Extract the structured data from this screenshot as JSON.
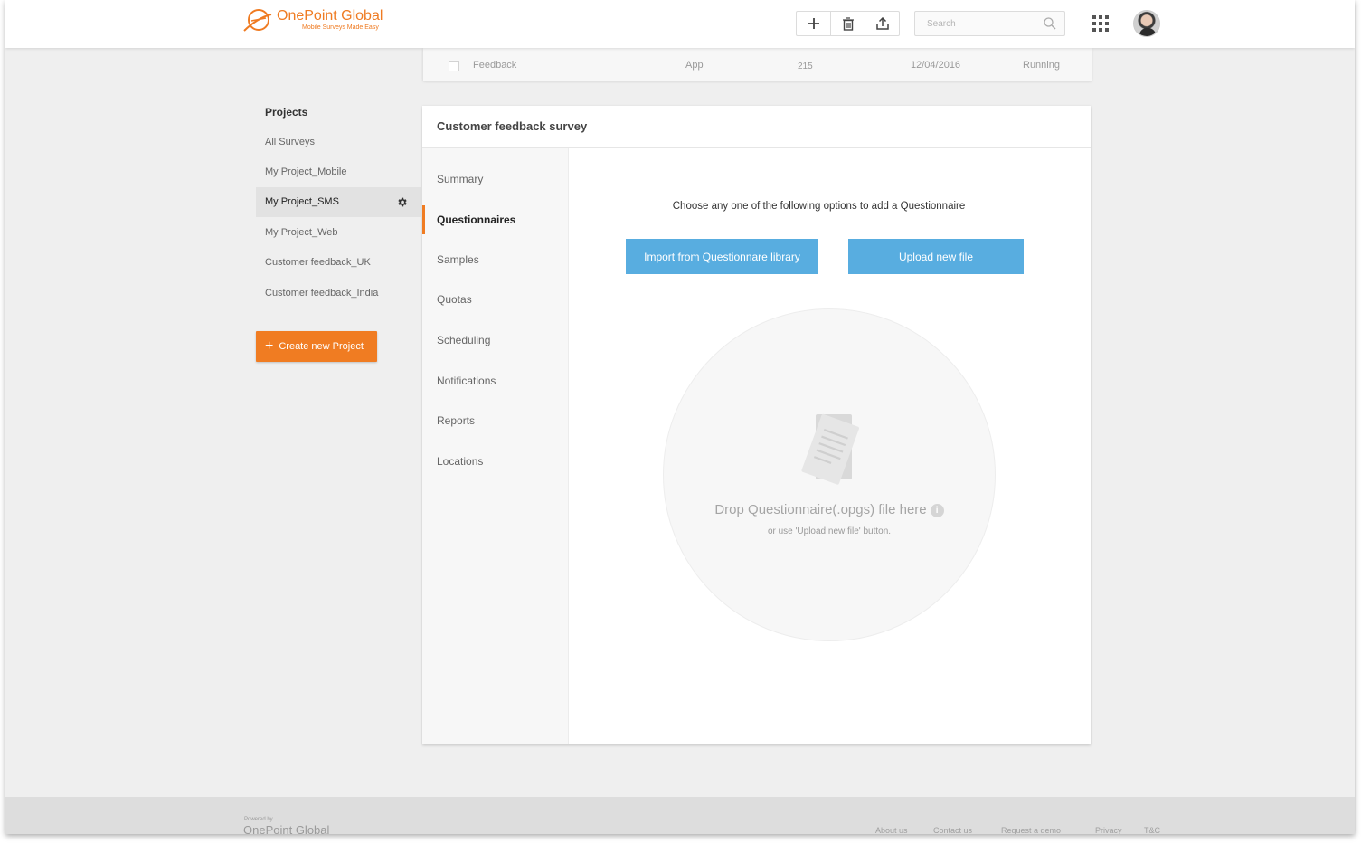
{
  "header": {
    "brand_name": "OnePoint Global",
    "brand_tagline": "Mobile Surveys Made Easy",
    "search_placeholder": "Search"
  },
  "survey_row": {
    "name": "Feedback",
    "type": "App",
    "count": "215",
    "date": "12/04/2016",
    "status": "Running"
  },
  "sidebar": {
    "title": "Projects",
    "items": [
      {
        "label": "All Surveys"
      },
      {
        "label": "My Project_Mobile"
      },
      {
        "label": "My Project_SMS"
      },
      {
        "label": "My Project_Web"
      },
      {
        "label": "Customer feedback_UK"
      },
      {
        "label": "Customer feedback_India"
      }
    ],
    "create_label": "Create new Project"
  },
  "card": {
    "title": "Customer feedback survey",
    "tabs": [
      {
        "label": "Summary"
      },
      {
        "label": "Questionnaires"
      },
      {
        "label": "Samples"
      },
      {
        "label": "Quotas"
      },
      {
        "label": "Scheduling"
      },
      {
        "label": "Notifications"
      },
      {
        "label": "Reports"
      },
      {
        "label": "Locations"
      }
    ],
    "instruction": "Choose any one of the following options to add a Questionnaire",
    "import_label": "Import from Questionnare library",
    "upload_label": "Upload new file",
    "drop_text": "Drop Questionnaire(.opgs) file here",
    "drop_subtext": "or use 'Upload new file' button."
  },
  "footer": {
    "powered_by": "Powered by",
    "brand": "OnePoint Global",
    "links": [
      {
        "label": "About us"
      },
      {
        "label": "Contact us"
      },
      {
        "label": "Request a demo"
      },
      {
        "label": "Privacy"
      },
      {
        "label": "T&C"
      }
    ]
  },
  "colors": {
    "accent": "#f07c22",
    "primary_button": "#58ade0"
  },
  "icons": [
    "logo-swoosh-icon",
    "plus-icon",
    "trash-icon",
    "upload-icon",
    "search-icon",
    "apps-grid-icon",
    "gear-icon",
    "document-icon",
    "info-icon"
  ]
}
